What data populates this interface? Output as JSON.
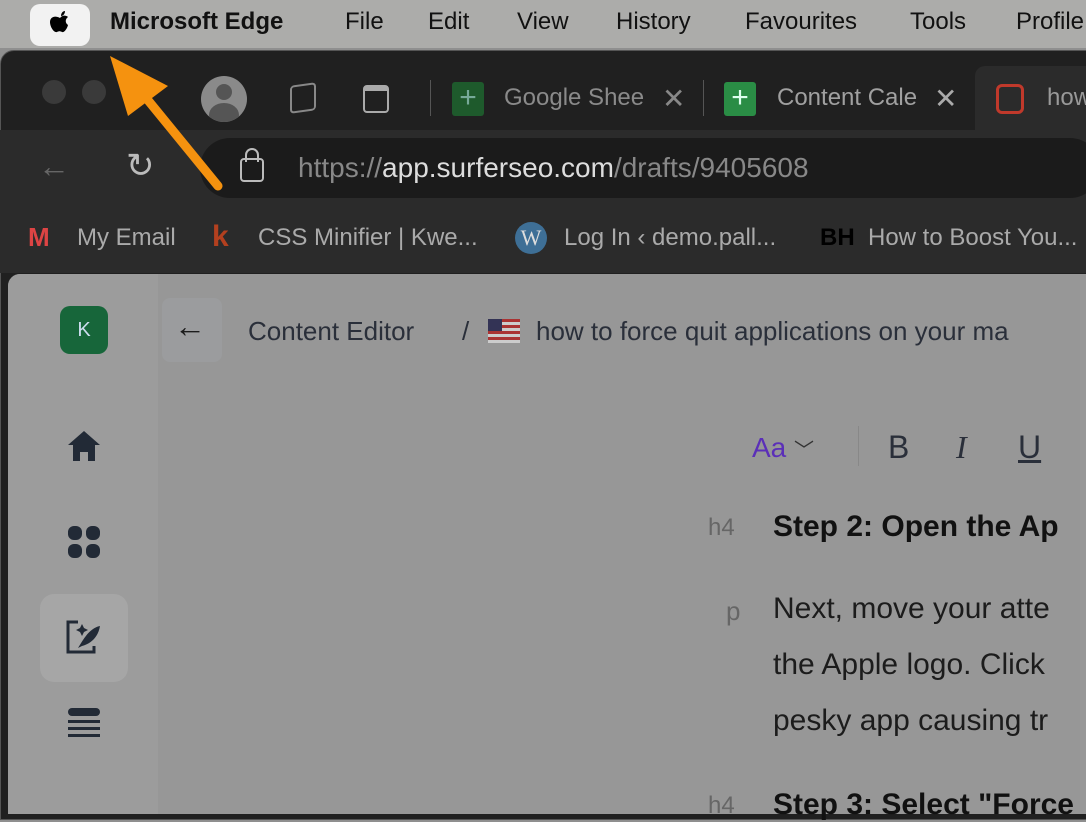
{
  "menubar": {
    "app": "Microsoft Edge",
    "items": [
      "File",
      "Edit",
      "View",
      "History",
      "Favourites",
      "Tools",
      "Profile"
    ]
  },
  "tabs": [
    {
      "label": "Google Shee",
      "icon": "google-sheets-icon"
    },
    {
      "label": "Content Cale",
      "icon": "google-sheets-icon"
    },
    {
      "label": "how",
      "icon": "surfer-icon"
    }
  ],
  "address": {
    "scheme": "https://",
    "host": "app.surferseo.com",
    "path": "/drafts/9405608"
  },
  "bookmarks": [
    {
      "label": "My Email",
      "icon": "gmail-icon"
    },
    {
      "label": "CSS Minifier | Kwe...",
      "icon": "kwe-icon"
    },
    {
      "label": "Log In ‹ demo.pall...",
      "icon": "wordpress-icon"
    },
    {
      "label": "How to Boost You...",
      "icon": "bh-icon"
    }
  ],
  "app": {
    "avatar": "K",
    "breadcrumb": "Content Editor",
    "separator": "/",
    "doc_title": "how to force quit applications on your ma",
    "toolbar": {
      "style": "Aa",
      "bold": "B",
      "italic": "I",
      "underline": "U"
    },
    "blocks": [
      {
        "tag": "h4",
        "text": "Step 2: Open the Ap"
      },
      {
        "tag": "p",
        "lines": [
          "Next, move your atte",
          "the Apple logo. Click",
          "pesky app causing tr"
        ]
      },
      {
        "tag": "h4",
        "text": "Step 3: Select \"Force"
      }
    ]
  },
  "colors": {
    "accent": "#5b2fb8",
    "arrow": "#f5920f",
    "avatar": "#17663a"
  }
}
